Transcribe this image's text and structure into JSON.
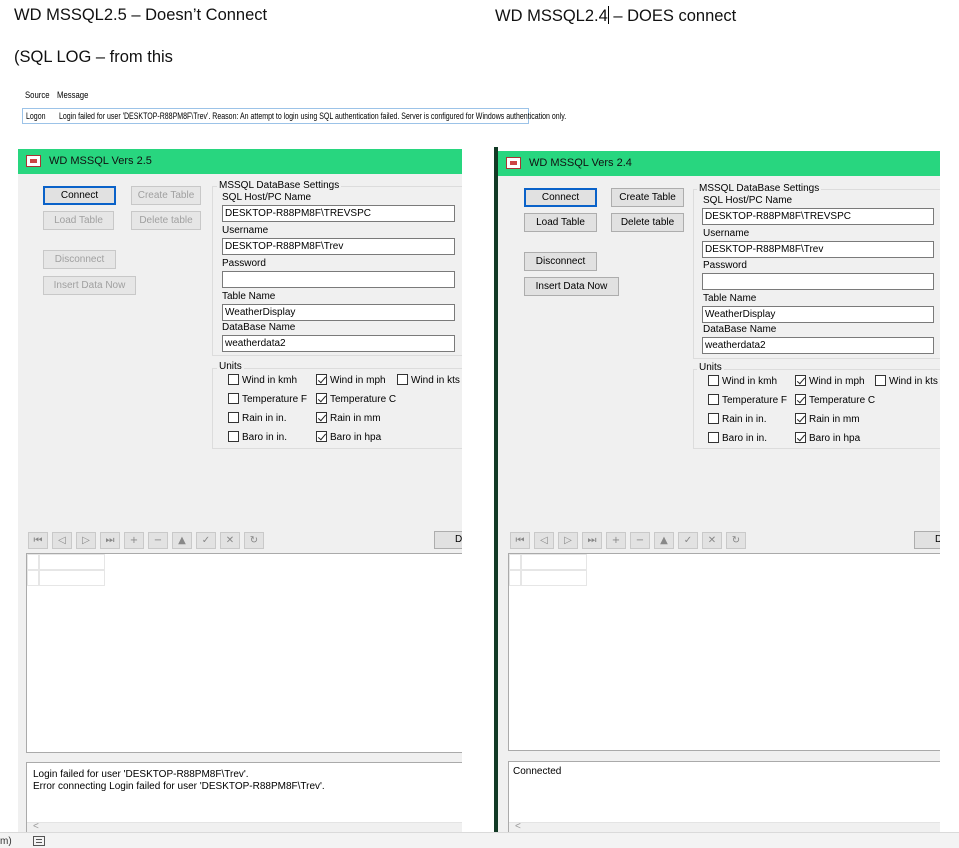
{
  "doc": {
    "heading_left": "WD MSSQL2.5 – Doesn’t Connect",
    "heading_right_a": "WD MSSQL2.4",
    "heading_right_b": " – DOES connect",
    "subheading": "(SQL LOG – from this"
  },
  "sql_log": {
    "col_source": "Source",
    "col_message": "Message",
    "row_source": "Logon",
    "row_message": "Login failed for user 'DESKTOP-R88PM8F\\Trev'. Reason: An attempt to login using SQL authentication failed. Server is configured for Windows authentication only."
  },
  "windows": [
    {
      "title": "WD MSSQL Vers 2.5",
      "buttons": {
        "connect": "Connect",
        "create_table": "Create Table",
        "load_table": "Load Table",
        "delete_table": "Delete table",
        "disconnect": "Disconnect",
        "insert_data": "Insert Data Now"
      },
      "settings": {
        "group_label": "MSSQL DataBase Settings",
        "host_label": "SQL Host/PC Name",
        "host_value": "DESKTOP-R88PM8F\\TREVSPC",
        "username_label": "Username",
        "username_value": "DESKTOP-R88PM8F\\Trev",
        "password_label": "Password",
        "password_value": "",
        "table_label": "Table Name",
        "table_value": "WeatherDisplay",
        "database_label": "DataBase Name",
        "database_value": "weatherdata2"
      },
      "units": {
        "label": "Units",
        "wind_kmh": "Wind in kmh",
        "wind_mph": "Wind in mph",
        "wind_kts": "Wind in kts",
        "temp_f": "Temperature F",
        "temp_c": "Temperature C",
        "rain_in": "Rain in in.",
        "rain_mm": "Rain in mm",
        "baro_in": "Baro in in.",
        "baro_hpa": "Baro in hpa"
      },
      "navigator_button": "D",
      "log_text": "Login failed for user 'DESKTOP-R88PM8F\\Trev'.\nError connecting Login failed for user 'DESKTOP-R88PM8F\\Trev'.",
      "scroll_arrow": "<"
    },
    {
      "title": "WD MSSQL Vers 2.4",
      "buttons": {
        "connect": "Connect",
        "create_table": "Create Table",
        "load_table": "Load Table",
        "delete_table": "Delete table",
        "disconnect": "Disconnect",
        "insert_data": "Insert Data Now"
      },
      "settings": {
        "group_label": "MSSQL DataBase Settings",
        "host_label": "SQL Host/PC Name",
        "host_value": "DESKTOP-R88PM8F\\TREVSPC",
        "username_label": "Username",
        "username_value": "DESKTOP-R88PM8F\\Trev",
        "password_label": "Password",
        "password_value": "",
        "table_label": "Table Name",
        "table_value": "WeatherDisplay",
        "database_label": "DataBase Name",
        "database_value": "weatherdata2"
      },
      "units": {
        "label": "Units",
        "wind_kmh": "Wind in kmh",
        "wind_mph": "Wind in mph",
        "wind_kts": "Wind in kts",
        "temp_f": "Temperature F",
        "temp_c": "Temperature C",
        "rain_in": "Rain in in.",
        "rain_mm": "Rain in mm",
        "baro_in": "Baro in in.",
        "baro_hpa": "Baro in hpa"
      },
      "navigator_button": "D",
      "log_text": "Connected",
      "scroll_arrow": "<"
    }
  ],
  "navigator_icons": [
    "first-icon",
    "prior-icon",
    "next-icon",
    "last-icon",
    "insert-icon",
    "delete-icon",
    "edit-icon",
    "post-icon",
    "cancel-icon",
    "refresh-icon"
  ],
  "status": {
    "text": "m)"
  },
  "colors": {
    "titlebar": "#28d67f",
    "default_button_border": "#0a62c9"
  }
}
